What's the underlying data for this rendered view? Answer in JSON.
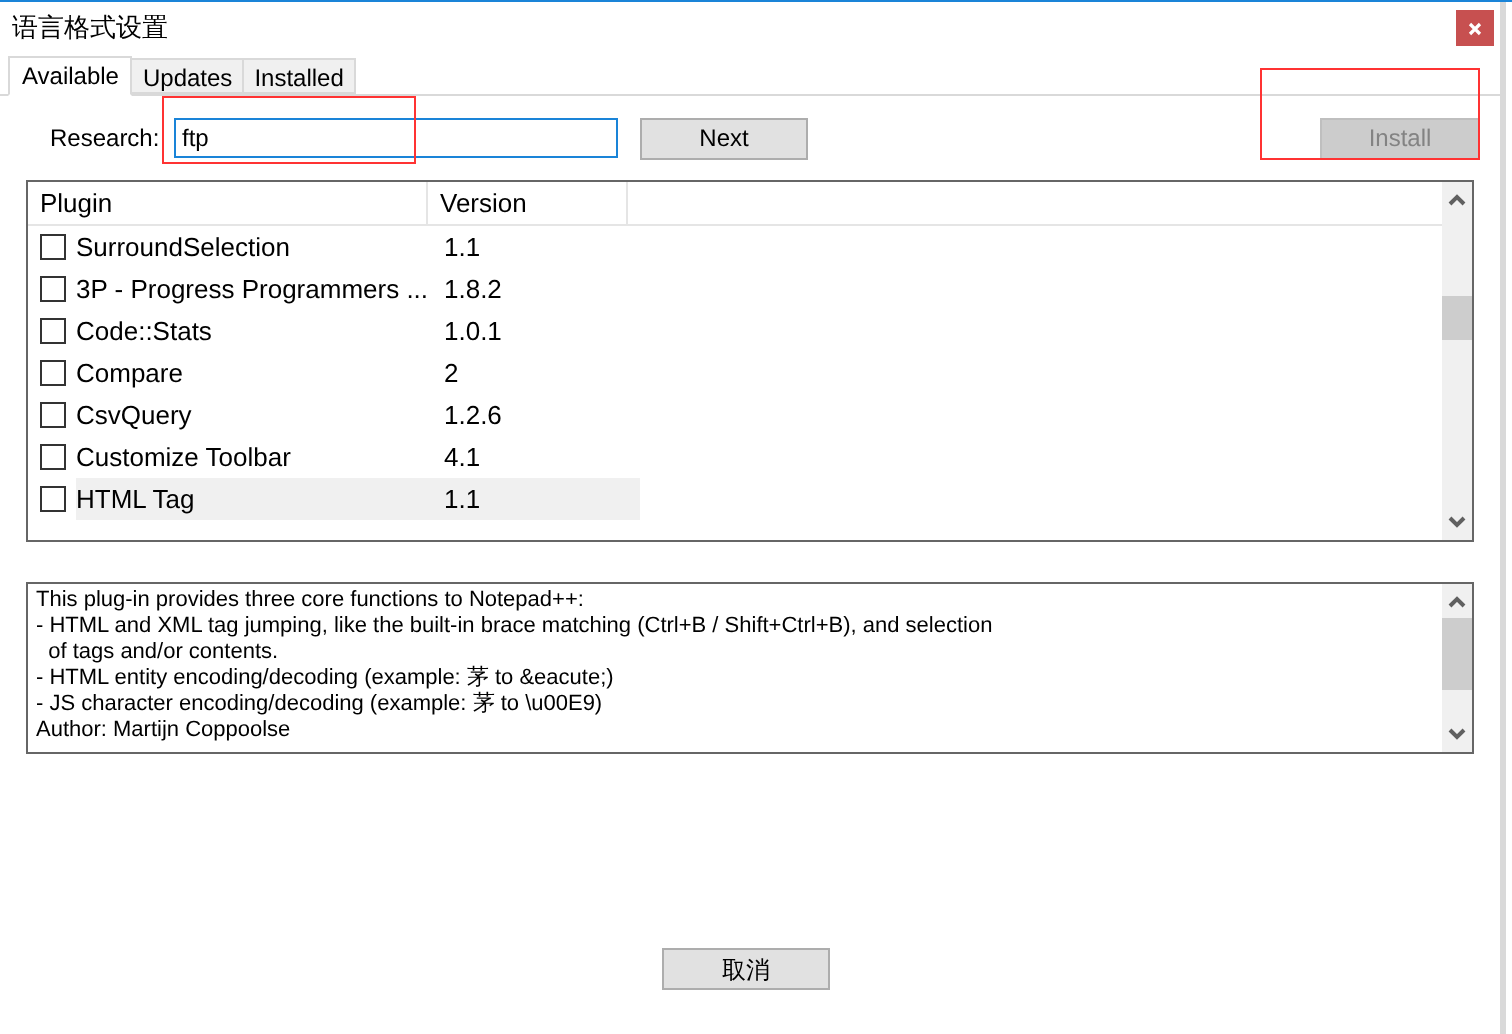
{
  "window": {
    "title": "语言格式设置"
  },
  "tabs": [
    {
      "label": "Available",
      "selected": true
    },
    {
      "label": "Updates",
      "selected": false
    },
    {
      "label": "Installed",
      "selected": false
    }
  ],
  "search": {
    "label": "Research:",
    "value": "ftp",
    "highlighted": true
  },
  "next_button": {
    "label": "Next"
  },
  "install_button": {
    "label": "Install",
    "disabled": true,
    "highlighted": true
  },
  "table": {
    "columns": [
      "Plugin",
      "Version"
    ],
    "rows": [
      {
        "checked": false,
        "selected": false,
        "cells": [
          "SurroundSelection",
          "1.1"
        ]
      },
      {
        "checked": false,
        "selected": false,
        "cells": [
          "3P - Progress Programmers ...",
          "1.8.2"
        ]
      },
      {
        "checked": false,
        "selected": false,
        "cells": [
          "Code::Stats",
          "1.0.1"
        ]
      },
      {
        "checked": false,
        "selected": false,
        "cells": [
          "Compare",
          "2"
        ]
      },
      {
        "checked": false,
        "selected": false,
        "cells": [
          "CsvQuery",
          "1.2.6"
        ]
      },
      {
        "checked": false,
        "selected": false,
        "cells": [
          "Customize Toolbar",
          "4.1"
        ]
      },
      {
        "checked": false,
        "selected": true,
        "cells": [
          "HTML Tag",
          "1.1"
        ]
      }
    ]
  },
  "description": [
    "This plug-in provides three core functions to Notepad++:",
    "- HTML and XML tag jumping, like the built-in brace matching (Ctrl+B / Shift+Ctrl+B), and selection",
    "  of tags and/or contents.",
    "- HTML entity encoding/decoding (example: 茅 to &eacute;)",
    "- JS character encoding/decoding (example: 茅 to \\u00E9)",
    "Author: Martijn Coppoolse"
  ],
  "cancel_button": {
    "label": "取消"
  }
}
